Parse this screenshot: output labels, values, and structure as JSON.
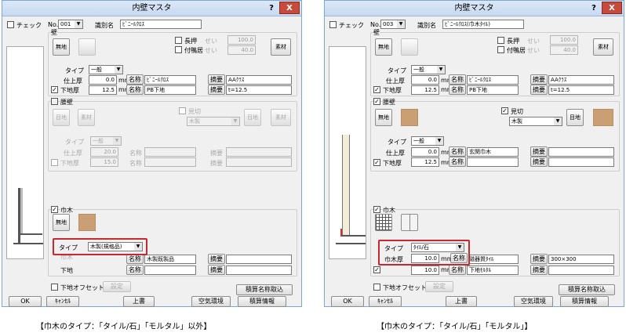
{
  "dialogs": [
    {
      "title": "内壁マスタ",
      "help": "?",
      "close": "X",
      "check_label": "チェック",
      "no_label": "No.",
      "no_value": "001",
      "name_label": "識別名",
      "name_value": "ﾋﾞﾆｰﾙｸﾛｽ",
      "wall": {
        "group": "壁",
        "base_btn": "無地",
        "nageshi": "長押",
        "tsukekamoi": "付鴨居",
        "sei": "せい",
        "nageshi_val": "100.0",
        "tsukekamoi_val": "40.0",
        "material_btn": "素材",
        "type_label": "タイプ",
        "type_value": "一般",
        "finish_label": "仕上厚",
        "finish_val": "0.0",
        "mm": "mm",
        "sub_label": "下地厚",
        "sub_val": "12.5",
        "meisho": "名称",
        "tekiyo": "摘要",
        "finish_name": "ﾋﾞﾆｰﾙｸﾛｽ",
        "finish_note": "AAｸﾗｽ",
        "sub_name": "PB下地",
        "sub_note": "t=12.5"
      },
      "koshikabe": {
        "group": "腰壁",
        "eji_btn": "目地",
        "material_btn": "素材",
        "mikiri": "見切",
        "mikiri_sel": "木製",
        "eji_btn2": "目地",
        "material_btn2": "素材",
        "type_label": "タイプ",
        "type_value": "一般",
        "finish_label": "仕上厚",
        "finish_val": "20.0",
        "sub_label": "下地厚",
        "sub_val": "15.0",
        "meisho": "名称",
        "tekiyo": "摘要"
      },
      "habaki": {
        "group": "巾木",
        "base_btn": "無地",
        "type_label": "タイプ",
        "type_value": "木製(規格品)",
        "obscured_label": "巾木",
        "finish_name": "木製既製品",
        "sub_label": "下地",
        "meisho": "名称",
        "tekiyo": "摘要"
      },
      "footer": {
        "offset": "下地オフセット",
        "setting": "設定",
        "names": "積算名称取込",
        "ok": "OK",
        "cancel": "ｷｬﾝｾﾙ",
        "overwrite": "上書",
        "env": "空気環境",
        "info": "積算情報"
      }
    },
    {
      "title": "内壁マスタ",
      "help": "?",
      "close": "X",
      "check_label": "チェック",
      "no_label": "No.",
      "no_value": "003",
      "name_label": "識別名",
      "name_value": "ﾋﾞﾆｰﾙｸﾛｽ(巾木ﾀｲﾙ)",
      "wall": {
        "group": "壁",
        "base_btn": "無地",
        "nageshi": "長押",
        "tsukekamoi": "付鴨居",
        "sei": "せい",
        "nageshi_val": "100.0",
        "tsukekamoi_val": "40.0",
        "material_btn": "素材",
        "type_label": "タイプ",
        "type_value": "一般",
        "finish_label": "仕上厚",
        "finish_val": "0.0",
        "mm": "mm",
        "sub_label": "下地厚",
        "sub_val": "12.5",
        "meisho": "名称",
        "tekiyo": "摘要",
        "finish_name": "ﾋﾞﾆｰﾙｸﾛｽ",
        "finish_note": "AAｸﾗｽ",
        "sub_name": "PB下地",
        "sub_note": "t=12.5"
      },
      "koshikabe": {
        "group": "腰壁",
        "base_btn": "無地",
        "mikiri": "見切",
        "mikiri_sel": "木製",
        "eji_btn2": "目地",
        "type_label": "タイプ",
        "type_value": "一般",
        "finish_label": "仕上厚",
        "finish_val": "0.0",
        "sub_label": "下地厚",
        "sub_val": "12.5",
        "mm": "mm",
        "meisho": "名称",
        "tekiyo": "摘要",
        "finish_name": "玄関巾木"
      },
      "habaki": {
        "group": "巾木",
        "type_label": "タイプ",
        "type_value": "ﾀｲﾙ/石",
        "thick_label": "巾木厚",
        "thick_val": "10.0",
        "mm": "mm",
        "finish_name": "磁器質ﾀｲﾙ",
        "finish_note": "300×300",
        "obscured_val": "10.0",
        "sub_name": "下地ﾓﾙﾀﾙ",
        "meisho": "名称",
        "tekiyo": "摘要"
      },
      "footer": {
        "offset": "下地オフセット",
        "setting": "設定",
        "names": "積算名称取込",
        "ok": "OK",
        "cancel": "ｷｬﾝｾﾙ",
        "overwrite": "上書",
        "env": "空気環境",
        "info": "積算情報"
      }
    }
  ],
  "captions": [
    "【巾木のタイプ：「タイル/石」「モルタル」以外】",
    "【巾木のタイプ：「タイル/石」「モルタル」】"
  ],
  "colors": {
    "highlight": "#c8282e",
    "swatch": "#c99f73",
    "titlebar": "#dbe8f8"
  }
}
